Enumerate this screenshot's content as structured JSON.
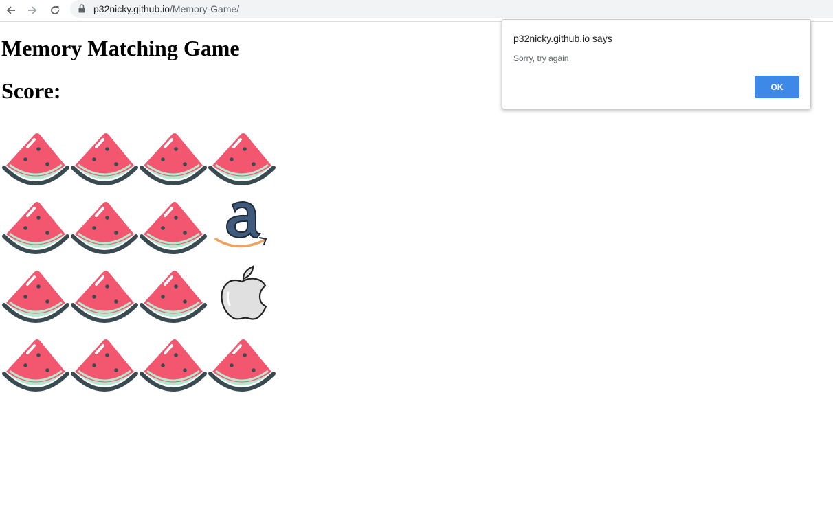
{
  "browser": {
    "url_host": "p32nicky.github.io",
    "url_path": "/Memory-Game/",
    "icons": [
      "back-arrow-icon",
      "forward-arrow-icon",
      "reload-icon",
      "lock-icon"
    ]
  },
  "page": {
    "title": "Memory Matching Game",
    "score_label": "Score:"
  },
  "game": {
    "rows": 4,
    "cols": 4,
    "cards": [
      "watermelon",
      "watermelon",
      "watermelon",
      "watermelon",
      "watermelon",
      "watermelon",
      "watermelon",
      "amazon-logo",
      "watermelon",
      "watermelon",
      "watermelon",
      "apple-logo",
      "watermelon",
      "watermelon",
      "watermelon",
      "watermelon"
    ]
  },
  "alert": {
    "title": "p32nicky.github.io says",
    "message": "Sorry, try again",
    "ok_label": "OK",
    "ok_color": "#3e88e8"
  },
  "colors": {
    "watermelon_flesh": "#f3566f",
    "watermelon_rind_inner": "#b6e7cf",
    "watermelon_rind_outer": "#3a4a51",
    "amazon_letter": "#3f5a7b",
    "amazon_smile": "#f0a35c",
    "apple_body": "#e0e0e0"
  }
}
